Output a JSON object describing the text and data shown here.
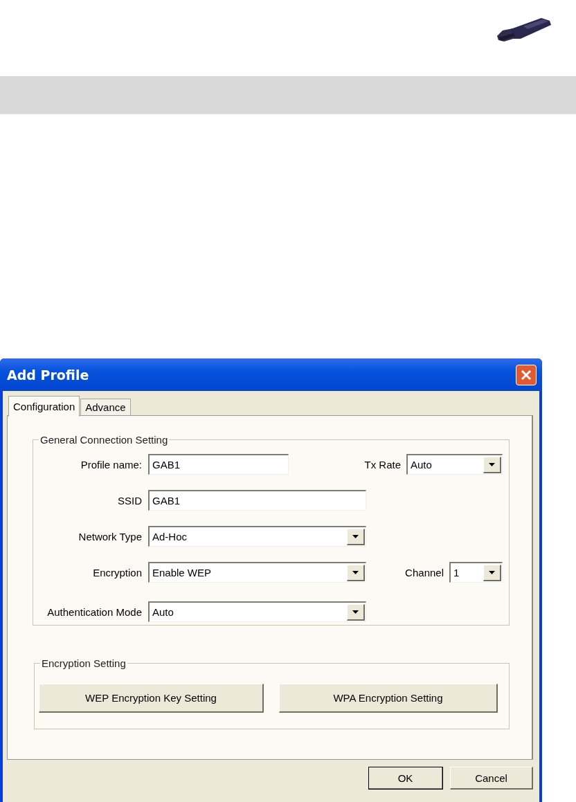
{
  "window": {
    "title": "Add Profile"
  },
  "tabs": [
    {
      "label": "Configuration",
      "selected": true
    },
    {
      "label": "Advance",
      "selected": false
    }
  ],
  "general_group": {
    "title": "General Connection Setting",
    "profile_name": {
      "label": "Profile name:",
      "value": "GAB1"
    },
    "tx_rate": {
      "label": "Tx Rate",
      "value": "Auto"
    },
    "ssid": {
      "label": "SSID",
      "value": "GAB1"
    },
    "network_type": {
      "label": "Network Type",
      "value": "Ad-Hoc"
    },
    "encryption": {
      "label": "Encryption",
      "value": "Enable WEP"
    },
    "channel": {
      "label": "Channel",
      "value": "1"
    },
    "authentication_mode": {
      "label": "Authentication Mode",
      "value": "Auto"
    }
  },
  "encryption_group": {
    "title": "Encryption Setting",
    "buttons": [
      "WEP Encryption Key Setting",
      "WPA Encryption Setting"
    ]
  },
  "buttons": [
    "OK",
    "Cancel"
  ]
}
